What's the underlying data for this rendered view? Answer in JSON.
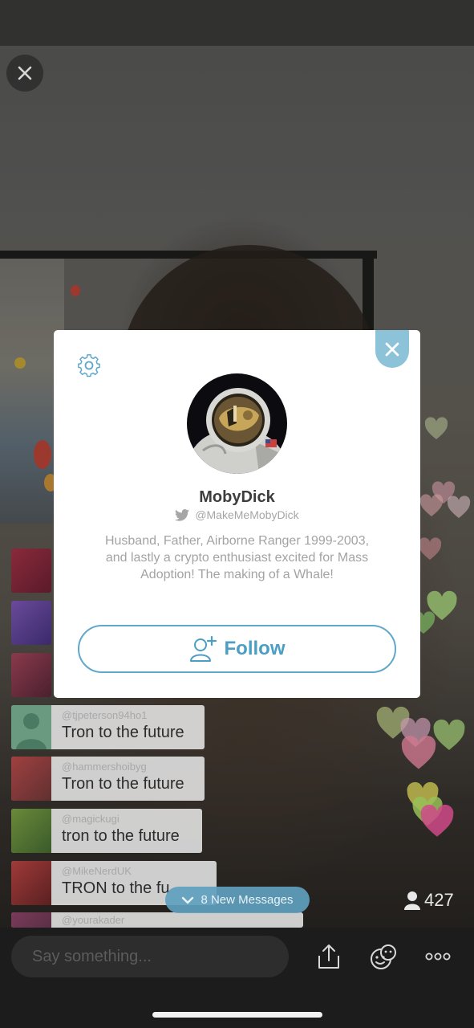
{
  "stream": {
    "viewer_count": "427",
    "new_messages_label": "8 New Messages"
  },
  "chat": {
    "messages": [
      {
        "user": "@tjpeterson94ho1",
        "text": "Tron to the future"
      },
      {
        "user": "@hammershoibyg",
        "text": "Tron to the future"
      },
      {
        "user": "@magickugi",
        "text": "tron to the future"
      },
      {
        "user": "@MikeNerdUK",
        "text": "TRON to the fu"
      },
      {
        "user": "@yourakader",
        "text": ""
      }
    ]
  },
  "input": {
    "placeholder": "Say something..."
  },
  "profile": {
    "name": "MobyDick",
    "twitter_handle": "@MakeMeMobyDick",
    "bio": "Husband, Father, Airborne Ranger 1999-2003, and lastly a crypto enthusiast excited for Mass Adoption! The making of a Whale!",
    "follow_label": "Follow"
  },
  "colors": {
    "accent": "#5fa8cb",
    "modal_close": "#8cc3d8"
  },
  "icons": {
    "close_top": "close-icon",
    "modal_close": "close-icon",
    "settings": "gear-icon",
    "twitter": "twitter-icon",
    "follow": "add-user-icon",
    "share": "share-icon",
    "stickers": "sticker-icon",
    "more": "more-icon",
    "viewers": "person-icon"
  }
}
